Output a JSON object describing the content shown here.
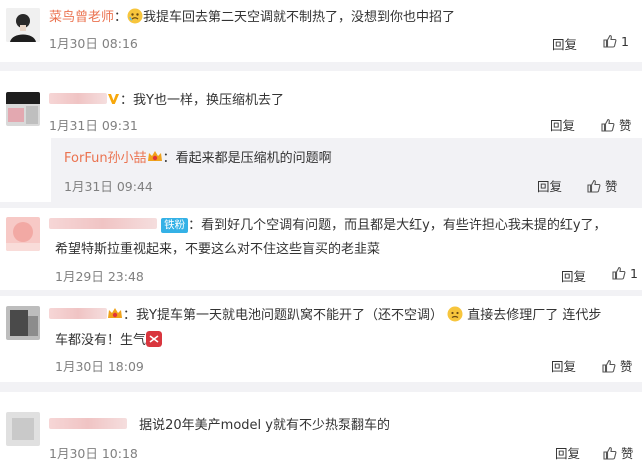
{
  "comments": [
    {
      "author": "菜鸟曾老师",
      "colon": "：",
      "text": "我提车回去第二天空调就不制热了，没想到你也中招了",
      "time": "1月30日 08:16",
      "reply_label": "回复",
      "like_count": "1",
      "avatar_icon": "avatar-portrait"
    },
    {
      "colon": "：",
      "text": "我Y也一样，换压缩机去了",
      "time": "1月31日 09:31",
      "reply_label": "回复",
      "like_label": "赞",
      "avatar_icon": "avatar-blurred",
      "nested_reply": {
        "author": "ForFun孙小喆",
        "colon": "：",
        "text": "看起来都是压缩机的问题啊",
        "time": "1月31日 09:44",
        "reply_label": "回复",
        "like_label": "赞"
      }
    },
    {
      "badge": "铁粉",
      "colon": "：",
      "text_line1": "看到好几个空调有问题，而且都是大红y，有些许担心我未提的红y了，",
      "text_line2": "希望特斯拉重视起来，不要这么对不住这些盲买的老韭菜",
      "time": "1月29日 23:48",
      "reply_label": "回复",
      "like_count": "1",
      "avatar_icon": "avatar-blurred-pink"
    },
    {
      "colon": "：",
      "text_line1a": "我Y提车第一天就电池问题趴窝不能开了（还不空调）",
      "text_line1b": "直接去修理厂了 连代步",
      "text_line2": "车都没有！生气",
      "time": "1月30日 18:09",
      "reply_label": "回复",
      "like_label": "赞",
      "avatar_icon": "avatar-blurred-dark"
    },
    {
      "text": "据说20年美产model y就有不少热泵翻车的",
      "time": "1月30日 10:18",
      "reply_label": "回复",
      "like_label": "赞",
      "avatar_icon": "avatar-blurred-grey"
    }
  ],
  "colors": {
    "author": "#eb7350",
    "timestamp": "#808080",
    "badge": "#34b1e6",
    "separator": "#f2f2f5"
  },
  "icons": [
    "thumb-up-icon",
    "verified-v-icon",
    "fan-crown-icon",
    "emoji-icon"
  ]
}
